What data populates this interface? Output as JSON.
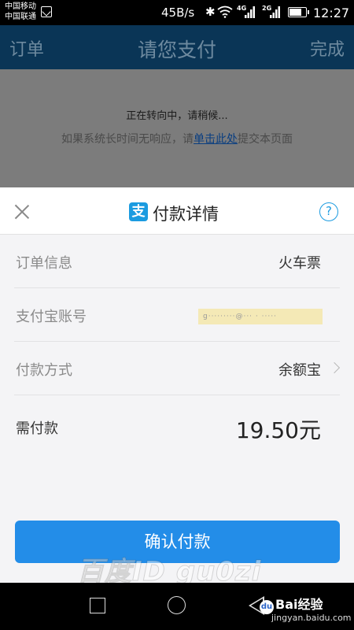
{
  "status_bar": {
    "carrier_1": "中国移动",
    "carrier_2": "中国联通",
    "network_speed": "45B/s",
    "signal_1_label": "4G",
    "signal_2_label": "2G",
    "battery_level": 0.7,
    "time": "12:27"
  },
  "header": {
    "left_label": "订单",
    "title": "请您支付",
    "right_label": "完成"
  },
  "redirect": {
    "message": "正在转向中，请稍候...",
    "hint_prefix": "如果系统长时间无响应，请",
    "hint_link": "单击此处",
    "hint_suffix": "提交本页面"
  },
  "payment_sheet": {
    "logo_char": "支",
    "title": "付款详情",
    "help_symbol": "?",
    "rows": [
      {
        "label": "订单信息",
        "value": "火车票"
      },
      {
        "label": "支付宝账号",
        "value": "g·········@··· · ·····"
      },
      {
        "label": "付款方式",
        "value": "余额宝"
      }
    ],
    "amount_label": "需付款",
    "amount_value": "19.50元",
    "confirm_label": "确认付款"
  },
  "watermark": "百度ID gu0zi",
  "branding": {
    "logo_text": "Bai经验",
    "paw_char": "du",
    "url": "jingyan.baidu.com"
  },
  "colors": {
    "accent": "#238de8",
    "alipay_blue": "#1b9be0",
    "header_bg": "#0a3556"
  }
}
